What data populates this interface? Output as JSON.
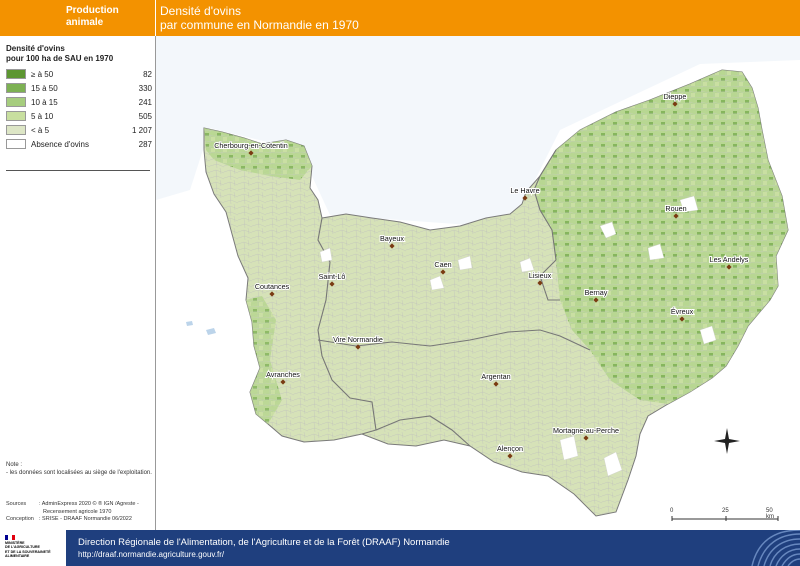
{
  "header": {
    "category_lines": [
      "Production",
      "animale"
    ],
    "title_lines": [
      "Densité d'ovins",
      "par commune en Normandie en 1970"
    ],
    "color": "#f39200"
  },
  "legend": {
    "title_lines": [
      "Densité d'ovins",
      "pour 100 ha de SAU en 1970"
    ],
    "classes": [
      {
        "label": "≥ à 50",
        "count": "82",
        "color": "#5d9631"
      },
      {
        "label": "15 à 50",
        "count": "330",
        "color": "#7db153"
      },
      {
        "label": "10 à 15",
        "count": "241",
        "color": "#a6cd7e"
      },
      {
        "label": "5 à 10",
        "count": "505",
        "color": "#c8df9f"
      },
      {
        "label": "< à 5",
        "count": "1 207",
        "color": "#dde6c6"
      },
      {
        "label": "Absence d'ovins",
        "count": "287",
        "color": "#ffffff"
      }
    ]
  },
  "note": {
    "title": "Note :",
    "text": "- les données sont localisées au siège de l'exploitation."
  },
  "sources": {
    "sources_key": "Sources",
    "sources_value_lines": [
      ": AdminExpress 2020 © ® IGN /Agreste -",
      "Recensement agricole 1970"
    ],
    "conception_key": "Conception",
    "conception_value": ": SRISE - DRAAF Normandie 06/2022"
  },
  "map": {
    "cities": [
      {
        "name": "Dieppe"
      },
      {
        "name": "Cherbourg-en-Cotentin"
      },
      {
        "name": "Le Havre"
      },
      {
        "name": "Rouen"
      },
      {
        "name": "Bayeux"
      },
      {
        "name": "Caen"
      },
      {
        "name": "Lisieux"
      },
      {
        "name": "Les Andelys"
      },
      {
        "name": "Saint-Lô"
      },
      {
        "name": "Coutances"
      },
      {
        "name": "Bernay"
      },
      {
        "name": "Évreux"
      },
      {
        "name": "Vire Normandie"
      },
      {
        "name": "Avranches"
      },
      {
        "name": "Argentan"
      },
      {
        "name": "Mortagne-au-Perche"
      },
      {
        "name": "Alençon"
      }
    ],
    "scale_labels": [
      "0",
      "25",
      "50 km"
    ],
    "sea_color": "#e4eef7"
  },
  "footer": {
    "logo_lines": [
      "MINISTÈRE",
      "DE L'AGRICULTURE",
      "ET DE LA SOUVERAINETÉ",
      "ALIMENTAIRE"
    ],
    "org": "Direction Régionale de l'Alimentation, de l'Agriculture et de la Forêt (DRAAF) Normandie",
    "url": "http://draaf.normandie.agriculture.gouv.fr/",
    "color": "#1f3f7e"
  }
}
